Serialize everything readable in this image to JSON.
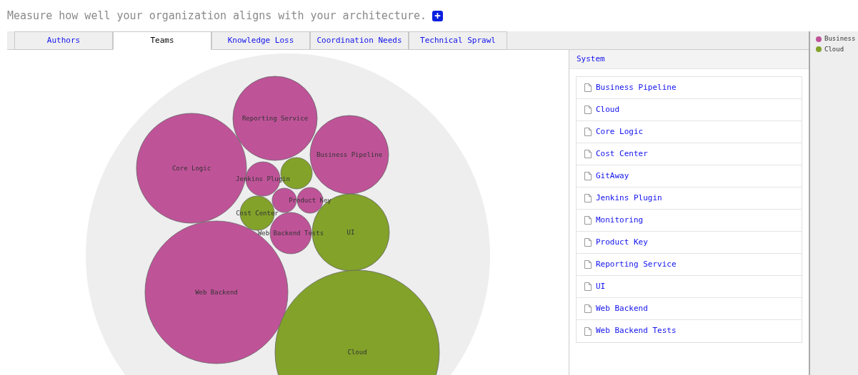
{
  "header": {
    "text": "Measure how well your organization aligns with your architecture.",
    "add_icon": "+"
  },
  "tabs": [
    {
      "label": "Authors",
      "selected": false
    },
    {
      "label": "Teams",
      "selected": true
    },
    {
      "label": "Knowledge Loss",
      "selected": false
    },
    {
      "label": "Coordination Needs",
      "selected": false
    },
    {
      "label": "Technical Sprawl",
      "selected": false
    }
  ],
  "bubbles": [
    {
      "label": "Reporting Service",
      "color": "#bf5398"
    },
    {
      "label": "Core Logic",
      "color": "#bf5398"
    },
    {
      "label": "Business Pipeline",
      "color": "#bf5398"
    },
    {
      "label": "Jenkins Plugin",
      "color": "#bf5398"
    },
    {
      "color": "#82a22a"
    },
    {
      "color": "#bf5398"
    },
    {
      "label": "Product Key",
      "color": "#bf5398"
    },
    {
      "label": "Cost Center",
      "color": "#82a22a"
    },
    {
      "label": "Web Backend Tests",
      "color": "#bf5398"
    },
    {
      "label": "UI",
      "color": "#82a22a"
    },
    {
      "label": "Web Backend",
      "color": "#bf5398"
    },
    {
      "label": "Cloud",
      "color": "#82a22a"
    }
  ],
  "system": {
    "title": "System",
    "items": [
      "Business Pipeline",
      "Cloud",
      "Core Logic",
      "Cost Center",
      "GitAway",
      "Jenkins Plugin",
      "Monitoring",
      "Product Key",
      "Reporting Service",
      "UI",
      "Web Backend",
      "Web Backend Tests"
    ]
  },
  "legend": [
    {
      "label": "Business",
      "color": "#bf5398"
    },
    {
      "label": "Cloud",
      "color": "#82a22a"
    }
  ]
}
